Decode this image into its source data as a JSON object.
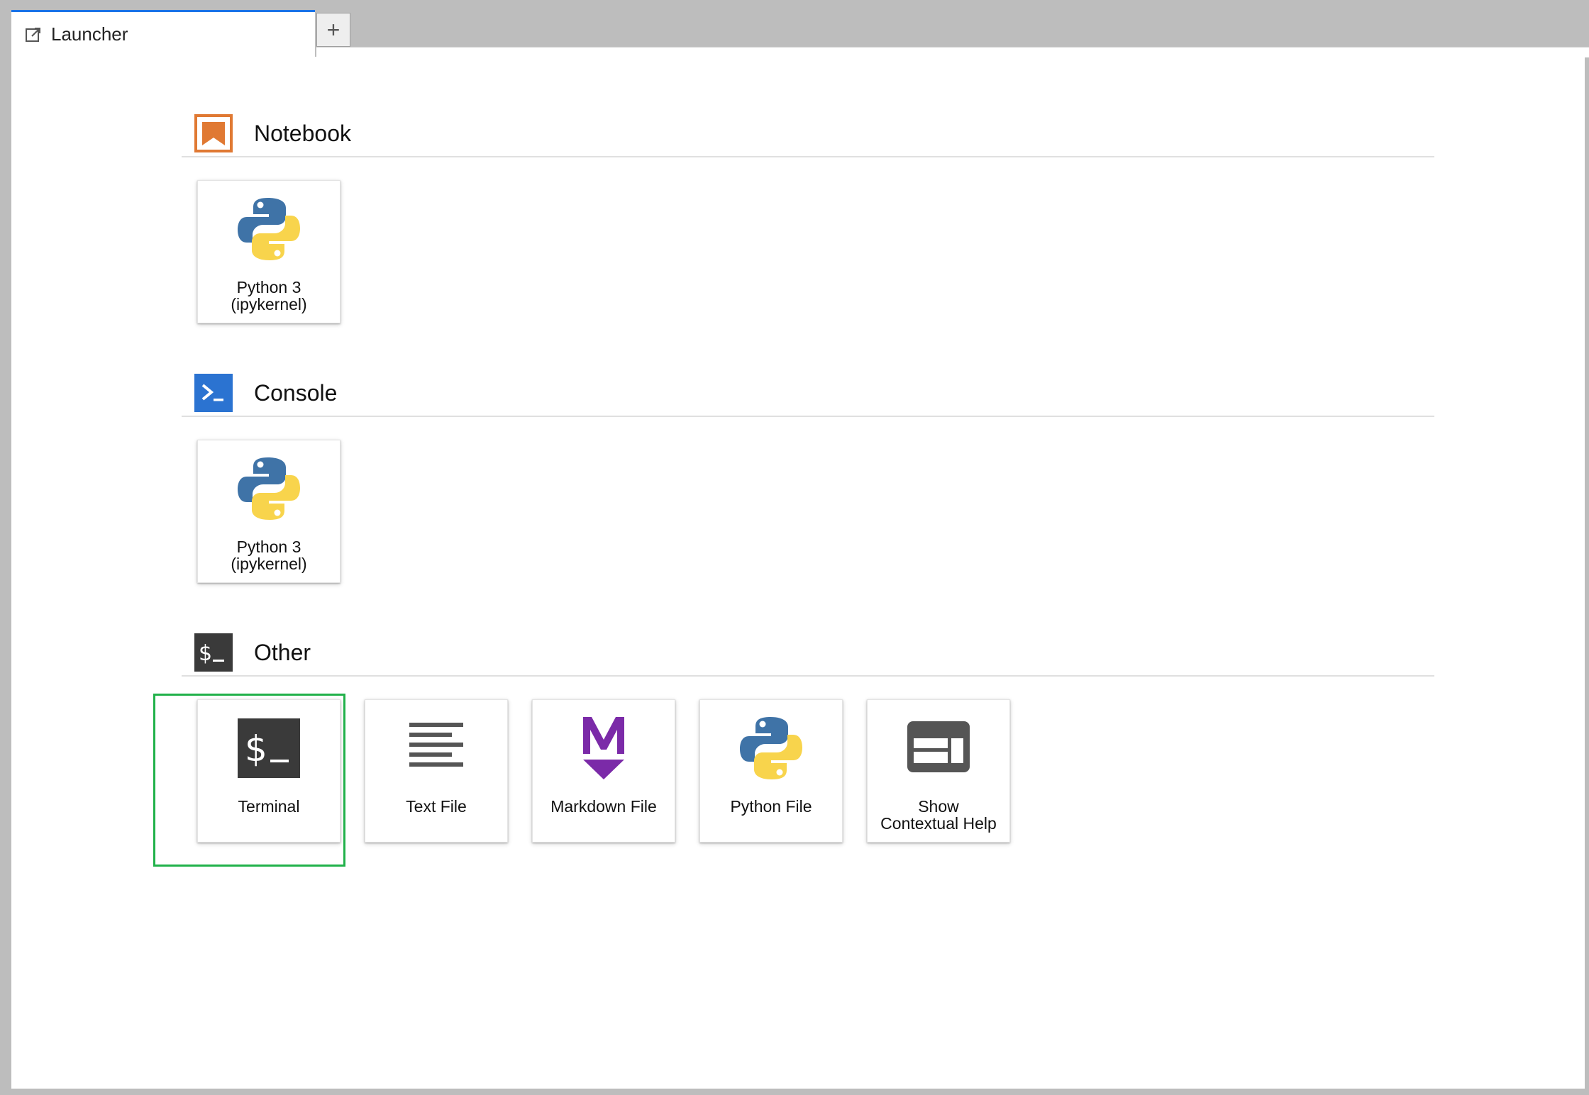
{
  "tabs": {
    "active_label": "Launcher",
    "add_symbol": "+"
  },
  "sections": [
    {
      "title": "Notebook",
      "icon": "notebook-icon",
      "color": "#e07933",
      "cards": [
        {
          "label_line1": "Python 3",
          "label_line2": "(ipykernel)",
          "icon": "python-logo-icon"
        }
      ]
    },
    {
      "title": "Console",
      "icon": "console-icon",
      "color": "#2b73d1",
      "cards": [
        {
          "label_line1": "Python 3",
          "label_line2": "(ipykernel)",
          "icon": "python-logo-icon"
        }
      ]
    },
    {
      "title": "Other",
      "icon": "terminal-icon",
      "color": "#3a3a3a",
      "cards": [
        {
          "label_line1": "Terminal",
          "label_line2": "",
          "icon": "terminal-icon"
        },
        {
          "label_line1": "Text File",
          "label_line2": "",
          "icon": "text-file-icon"
        },
        {
          "label_line1": "Markdown File",
          "label_line2": "",
          "icon": "markdown-icon"
        },
        {
          "label_line1": "Python File",
          "label_line2": "",
          "icon": "python-logo-icon"
        },
        {
          "label_line1": "Show",
          "label_line2": "Contextual Help",
          "icon": "contextual-help-icon"
        }
      ]
    }
  ],
  "colors": {
    "tab_accent": "#1a73e8",
    "highlight": "#21b14a",
    "markdown": "#7b2aa8",
    "python_blue": "#3f73a7",
    "python_yellow": "#f8d44c"
  }
}
